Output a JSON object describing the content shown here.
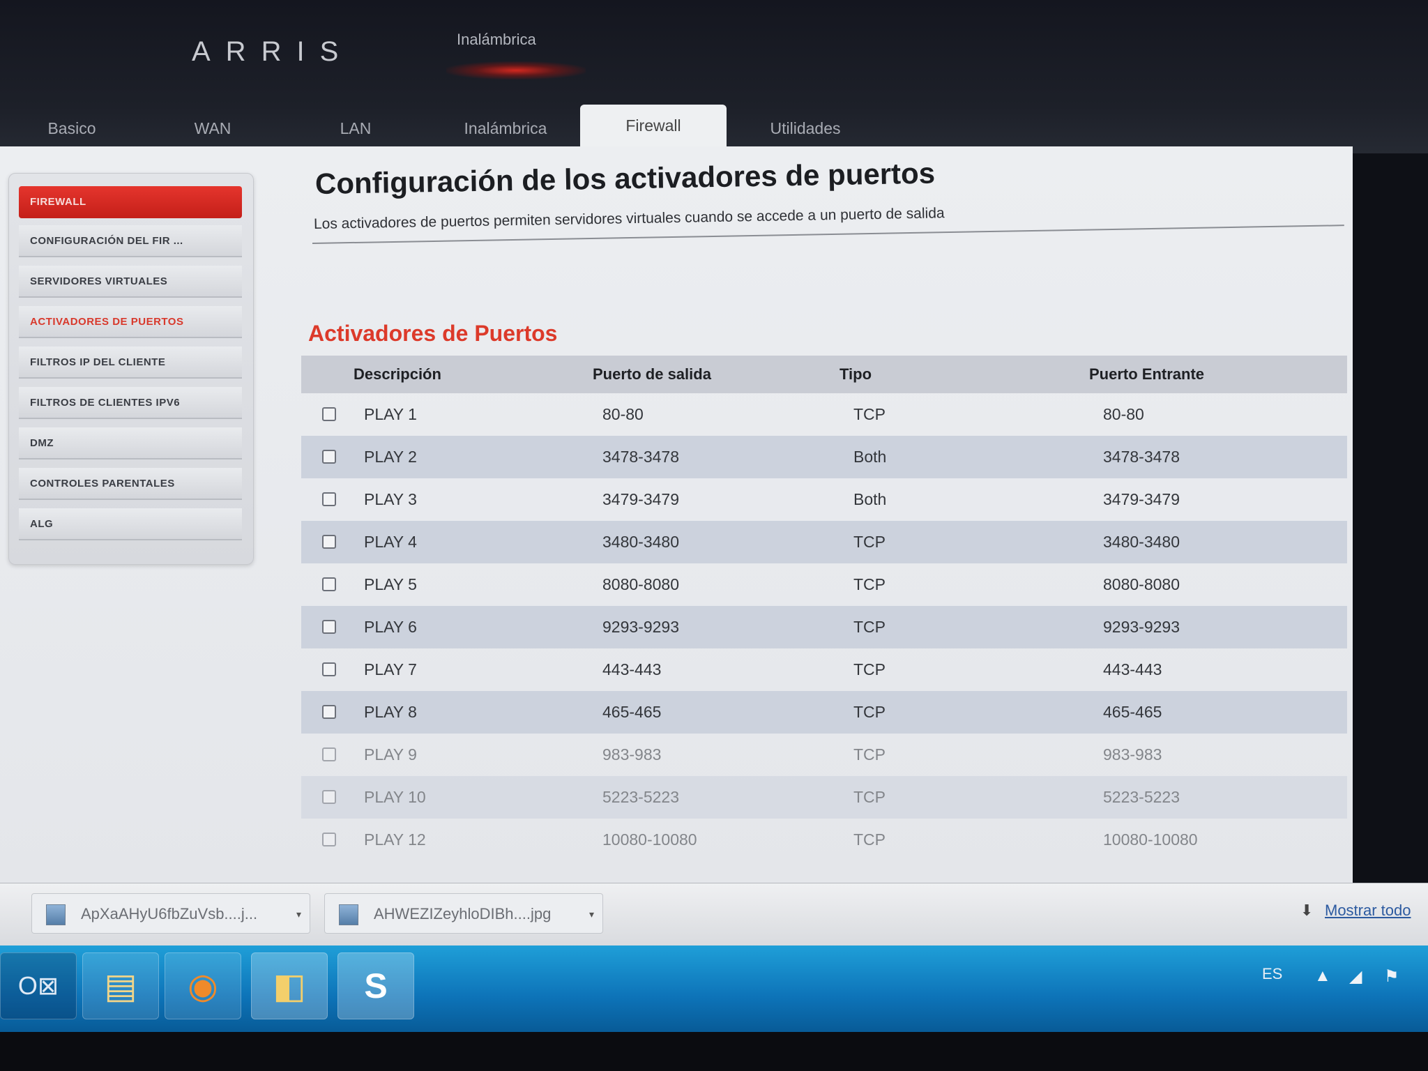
{
  "brand": {
    "logo": "ARRIS",
    "top_active": "Inalámbrica"
  },
  "tabs": [
    {
      "label": "Basico",
      "active": false
    },
    {
      "label": "WAN",
      "active": false
    },
    {
      "label": "LAN",
      "active": false
    },
    {
      "label": "Inalámbrica",
      "active": false
    },
    {
      "label": "Firewall",
      "active": true
    },
    {
      "label": "Utilidades",
      "active": false
    }
  ],
  "sidebar": {
    "header": "FIREWALL",
    "items": [
      {
        "label": "CONFIGURACIÓN DEL FIR ..."
      },
      {
        "label": "SERVIDORES VIRTUALES"
      },
      {
        "label": "ACTIVADORES DE PUERTOS",
        "current": true
      },
      {
        "label": "FILTROS IP DEL CLIENTE"
      },
      {
        "label": "FILTROS DE CLIENTES IPV6"
      },
      {
        "label": "DMZ"
      },
      {
        "label": "CONTROLES PARENTALES"
      },
      {
        "label": "ALG"
      }
    ]
  },
  "main": {
    "title": "Configuración de los activadores de puertos",
    "subtitle": "Los activadores de puertos permiten servidores virtuales cuando se accede a un puerto de salida",
    "section_title": "Activadores de Puertos",
    "columns": {
      "description": "Descripción",
      "out_port": "Puerto de salida",
      "type": "Tipo",
      "in_port": "Puerto Entrante"
    },
    "rows": [
      {
        "desc": "PLAY 1",
        "out": "80-80",
        "type": "TCP",
        "in": "80-80"
      },
      {
        "desc": "PLAY 2",
        "out": "3478-3478",
        "type": "Both",
        "in": "3478-3478"
      },
      {
        "desc": "PLAY 3",
        "out": "3479-3479",
        "type": "Both",
        "in": "3479-3479"
      },
      {
        "desc": "PLAY 4",
        "out": "3480-3480",
        "type": "TCP",
        "in": "3480-3480"
      },
      {
        "desc": "PLAY 5",
        "out": "8080-8080",
        "type": "TCP",
        "in": "8080-8080"
      },
      {
        "desc": "PLAY 6",
        "out": "9293-9293",
        "type": "TCP",
        "in": "9293-9293"
      },
      {
        "desc": "PLAY 7",
        "out": "443-443",
        "type": "TCP",
        "in": "443-443"
      },
      {
        "desc": "PLAY 8",
        "out": "465-465",
        "type": "TCP",
        "in": "465-465"
      },
      {
        "desc": "PLAY 9",
        "out": "983-983",
        "type": "TCP",
        "in": "983-983"
      },
      {
        "desc": "PLAY 10",
        "out": "5223-5223",
        "type": "TCP",
        "in": "5223-5223"
      },
      {
        "desc": "PLAY 12",
        "out": "10080-10080",
        "type": "TCP",
        "in": "10080-10080"
      }
    ]
  },
  "downloads": {
    "items": [
      {
        "name": "ApXaAHyU6fbZuVsb....j...",
        "icon": "image-file-icon"
      },
      {
        "name": "AHWEZIZeyhloDIBh....jpg",
        "icon": "image-file-icon"
      }
    ],
    "show_all": "Mostrar todo"
  },
  "taskbar": {
    "apps": [
      {
        "name": "outlook-icon",
        "glyph": "O⊠"
      },
      {
        "name": "file-explorer-icon",
        "glyph": "▤"
      },
      {
        "name": "firefox-icon",
        "glyph": "◉"
      },
      {
        "name": "folder-icon",
        "glyph": "◧"
      },
      {
        "name": "skype-icon",
        "glyph": "S"
      }
    ],
    "language": "ES"
  },
  "colors": {
    "accent_red": "#dc3a2a",
    "taskbar_blue": "#0d73b8",
    "row_alt": "#ccd2dd"
  }
}
